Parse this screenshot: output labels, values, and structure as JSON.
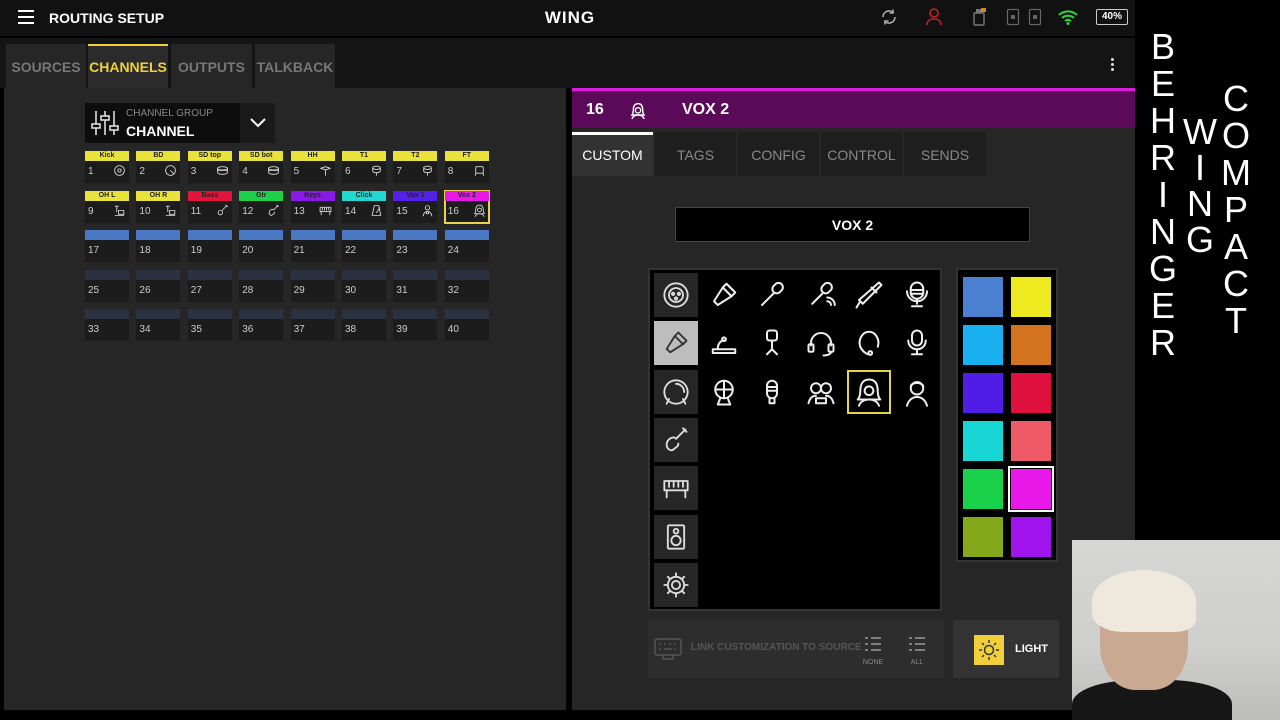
{
  "topbar": {
    "app_title": "ROUTING SETUP",
    "center_title": "WING",
    "battery": "40%",
    "battery_level": 0.4,
    "icons": [
      "menu-icon",
      "sync-icon",
      "user-icon",
      "slot-icon",
      "wifi-icon",
      "battery-icon"
    ]
  },
  "tabs": [
    "SOURCES",
    "CHANNELS",
    "OUTPUTS",
    "TALKBACK"
  ],
  "active_tab": "CHANNELS",
  "channel_group": {
    "label": "CHANNEL GROUP",
    "value": "CHANNEL"
  },
  "channels": [
    {
      "num": "1",
      "name": "Kick",
      "color": "#e8e23a",
      "icon": "kick-drum-icon"
    },
    {
      "num": "2",
      "name": "BD",
      "color": "#e8e23a",
      "icon": "bass-drum-icon"
    },
    {
      "num": "3",
      "name": "SD top",
      "color": "#e8e23a",
      "icon": "snare-icon"
    },
    {
      "num": "4",
      "name": "SD bot",
      "color": "#e8e23a",
      "icon": "snare-icon"
    },
    {
      "num": "5",
      "name": "HH",
      "color": "#e8e23a",
      "icon": "hihat-icon"
    },
    {
      "num": "6",
      "name": "T1",
      "color": "#e8e23a",
      "icon": "tom-icon"
    },
    {
      "num": "7",
      "name": "T2",
      "color": "#e8e23a",
      "icon": "tom-icon"
    },
    {
      "num": "8",
      "name": "FT",
      "color": "#e8e23a",
      "icon": "floor-tom-icon"
    },
    {
      "num": "9",
      "name": "OH L",
      "color": "#e8e23a",
      "icon": "overhead-icon"
    },
    {
      "num": "10",
      "name": "OH R",
      "color": "#e8e23a",
      "icon": "overhead-icon"
    },
    {
      "num": "11",
      "name": "Bass",
      "color": "#e0143c",
      "icon": "bass-guitar-icon"
    },
    {
      "num": "12",
      "name": "Gtr",
      "color": "#1fd14a",
      "icon": "guitar-icon"
    },
    {
      "num": "13",
      "name": "Keys",
      "color": "#8a18e6",
      "icon": "keyboard-icon"
    },
    {
      "num": "14",
      "name": "Click",
      "color": "#22d8d0",
      "icon": "metronome-icon"
    },
    {
      "num": "15",
      "name": "Vox 1",
      "color": "#5520e8",
      "icon": "singer-icon"
    },
    {
      "num": "16",
      "name": "Vox 2",
      "color": "#e818e8",
      "icon": "singer-female-icon"
    },
    {
      "num": "17",
      "name": "",
      "color": "#4a78c4",
      "icon": ""
    },
    {
      "num": "18",
      "name": "",
      "color": "#4a78c4",
      "icon": ""
    },
    {
      "num": "19",
      "name": "",
      "color": "#4a78c4",
      "icon": ""
    },
    {
      "num": "20",
      "name": "",
      "color": "#4a78c4",
      "icon": ""
    },
    {
      "num": "21",
      "name": "",
      "color": "#4a78c4",
      "icon": ""
    },
    {
      "num": "22",
      "name": "",
      "color": "#4a78c4",
      "icon": ""
    },
    {
      "num": "23",
      "name": "",
      "color": "#4a78c4",
      "icon": ""
    },
    {
      "num": "24",
      "name": "",
      "color": "#4a78c4",
      "icon": ""
    },
    {
      "num": "25",
      "name": "",
      "color": "#2a3140",
      "icon": ""
    },
    {
      "num": "26",
      "name": "",
      "color": "#2a3140",
      "icon": ""
    },
    {
      "num": "27",
      "name": "",
      "color": "#2a3140",
      "icon": ""
    },
    {
      "num": "28",
      "name": "",
      "color": "#2a3140",
      "icon": ""
    },
    {
      "num": "29",
      "name": "",
      "color": "#2a3140",
      "icon": ""
    },
    {
      "num": "30",
      "name": "",
      "color": "#2a3140",
      "icon": ""
    },
    {
      "num": "31",
      "name": "",
      "color": "#2a3140",
      "icon": ""
    },
    {
      "num": "32",
      "name": "",
      "color": "#2a3140",
      "icon": ""
    },
    {
      "num": "33",
      "name": "",
      "color": "#2a3140",
      "icon": ""
    },
    {
      "num": "34",
      "name": "",
      "color": "#2a3140",
      "icon": ""
    },
    {
      "num": "35",
      "name": "",
      "color": "#2a3140",
      "icon": ""
    },
    {
      "num": "36",
      "name": "",
      "color": "#2a3140",
      "icon": ""
    },
    {
      "num": "37",
      "name": "",
      "color": "#2a3140",
      "icon": ""
    },
    {
      "num": "38",
      "name": "",
      "color": "#2a3140",
      "icon": ""
    },
    {
      "num": "39",
      "name": "",
      "color": "#2a3140",
      "icon": ""
    },
    {
      "num": "40",
      "name": "",
      "color": "#2a3140",
      "icon": ""
    }
  ],
  "selected_channel": "16",
  "channel_header": {
    "num": "16",
    "name": "VOX 2",
    "color": "#e01ae0",
    "icon": "singer-female-icon"
  },
  "subtabs": [
    "CUSTOM",
    "TAGS",
    "CONFIG",
    "CONTROL",
    "SENDS"
  ],
  "active_subtab": "CUSTOM",
  "name_field": "VOX 2",
  "icon_categories": [
    "xlr-icon",
    "microphone-icon",
    "drum-icon",
    "guitar-icon",
    "keyboard-icon",
    "speaker-icon",
    "gear-icon"
  ],
  "active_category": "microphone-icon",
  "icons": [
    "handheld-mic-icon",
    "condenser-mic-icon",
    "wireless-mic-icon",
    "shotgun-mic-icon",
    "studio-mic-icon",
    "boundary-mic-icon",
    "podium-mic-icon",
    "headset-mic-icon",
    "lavalier-mic-icon",
    "tube-mic-icon",
    "speech-mic-icon",
    "ribbon-mic-icon",
    "duet-singers-icon",
    "singer-female-icon",
    "singer-male-icon"
  ],
  "selected_icon": "singer-female-icon",
  "swatches": [
    "#4b7fcf",
    "#eeea1f",
    "#18b0ee",
    "#d2731f",
    "#4f1de6",
    "#e0103e",
    "#18d6d4",
    "#ee5a66",
    "#19d14b",
    "#e818e8",
    "#83a81a",
    "#a014ee"
  ],
  "selected_swatch": "#e818e8",
  "link": {
    "label": "LINK CUSTOMIZATION TO SOURCE",
    "none": "NONE",
    "all": "ALL"
  },
  "light_button": "LIGHT",
  "brand_overlay": {
    "col1": [
      "B",
      "E",
      "H",
      "R",
      "I",
      "N",
      "G",
      "E",
      "R"
    ],
    "col2": [
      "W",
      "I",
      "N",
      "G"
    ],
    "col3": [
      "C",
      "O",
      "M",
      "P",
      "A",
      "C",
      "T"
    ]
  }
}
